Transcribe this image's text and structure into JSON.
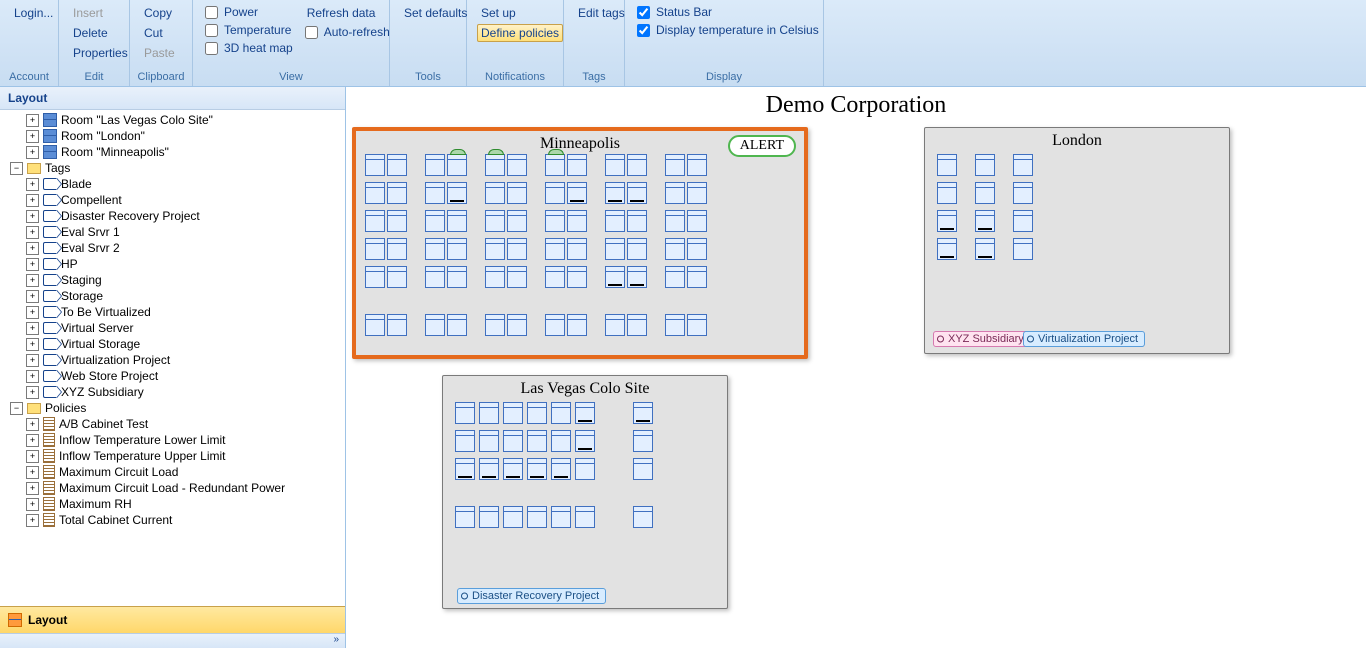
{
  "ribbon": {
    "account": {
      "login": "Login...",
      "title": "Account"
    },
    "edit": {
      "insert": "Insert",
      "delete": "Delete",
      "properties": "Properties",
      "title": "Edit"
    },
    "clipboard": {
      "copy": "Copy",
      "cut": "Cut",
      "paste": "Paste",
      "title": "Clipboard"
    },
    "view": {
      "power": "Power",
      "temperature": "Temperature",
      "heatmap": "3D heat map",
      "refresh": "Refresh data",
      "autorefresh": "Auto-refresh",
      "title": "View"
    },
    "tools": {
      "defaults": "Set defaults",
      "title": "Tools"
    },
    "notifications": {
      "setup": "Set up",
      "policies": "Define policies",
      "title": "Notifications"
    },
    "tags": {
      "edit": "Edit tags",
      "title": "Tags"
    },
    "display": {
      "statusbar": "Status Bar",
      "celsius": "Display temperature in Celsius",
      "title": "Display"
    }
  },
  "sidebar": {
    "header": "Layout",
    "rooms": [
      "Room \"Las Vegas Colo Site\"",
      "Room \"London\"",
      "Room \"Minneapolis\""
    ],
    "tags_label": "Tags",
    "tags": [
      "Blade",
      "Compellent",
      "Disaster Recovery Project",
      "Eval Srvr 1",
      "Eval Srvr 2",
      "HP",
      "Staging",
      "Storage",
      "To Be Virtualized",
      "Virtual Server",
      "Virtual Storage",
      "Virtualization Project",
      "Web Store Project",
      "XYZ Subsidiary"
    ],
    "policies_label": "Policies",
    "policies": [
      "A/B Cabinet Test",
      "Inflow Temperature Lower Limit",
      "Inflow Temperature Upper Limit",
      "Maximum Circuit Load",
      "Maximum Circuit Load - Redundant Power",
      "Maximum RH",
      "Total Cabinet Current"
    ],
    "footer": "Layout",
    "chevron": "»"
  },
  "canvas": {
    "title": "Demo Corporation",
    "rooms": {
      "minneapolis": {
        "title": "Minneapolis",
        "alert": "ALERT"
      },
      "london": {
        "title": "London",
        "tag1": "XYZ Subsidiary",
        "tag2": "Virtualization Project"
      },
      "vegas": {
        "title": "Las Vegas Colo Site",
        "tag1": "Disaster Recovery Project"
      }
    }
  }
}
